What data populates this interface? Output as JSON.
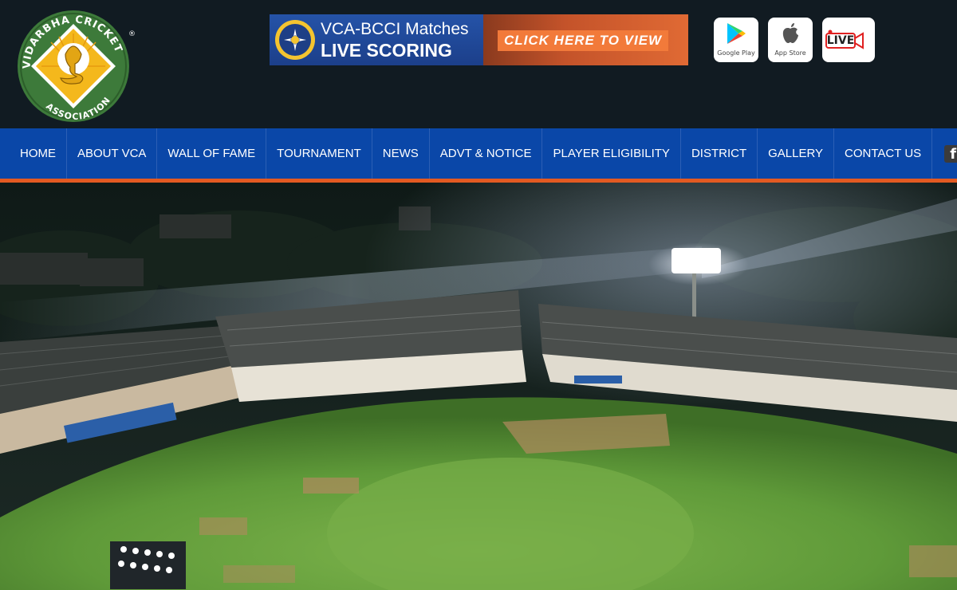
{
  "logo": {
    "org_name_top": "VIDARBHA CRICKET",
    "org_name_bottom": "ASSOCIATION",
    "registered_mark": "®",
    "colors": {
      "ring": "#3d7a3a",
      "field": "#f4b81c",
      "accent": "#ffffff"
    }
  },
  "banner": {
    "title": "VCA-BCCI Matches",
    "subtitle": "LIVE SCORING",
    "cta": "CLICK HERE TO VIEW",
    "colors": {
      "left": "#1c3f8a",
      "right": "#e06a34",
      "cta_bg": "#f27a3a"
    }
  },
  "app_links": {
    "google_play": {
      "icon": "google-play-icon",
      "caption": "Google Play"
    },
    "app_store": {
      "icon": "apple-icon",
      "caption": "App Store"
    },
    "live": {
      "icon": "live-camera-icon",
      "label": "LIVE"
    }
  },
  "nav": {
    "items": [
      {
        "label": "HOME"
      },
      {
        "label": "ABOUT VCA"
      },
      {
        "label": "WALL OF FAME"
      },
      {
        "label": "TOURNAMENT"
      },
      {
        "label": "NEWS"
      },
      {
        "label": "ADVT & NOTICE"
      },
      {
        "label": "PLAYER ELIGIBILITY"
      },
      {
        "label": "DISTRICT"
      },
      {
        "label": "GALLERY"
      },
      {
        "label": "CONTACT US"
      }
    ],
    "facebook_icon": "facebook-icon",
    "colors": {
      "bar": "#0a47a8",
      "stripe": "#e25a22"
    }
  },
  "hero": {
    "image": "night-cricket-stadium-photo"
  }
}
